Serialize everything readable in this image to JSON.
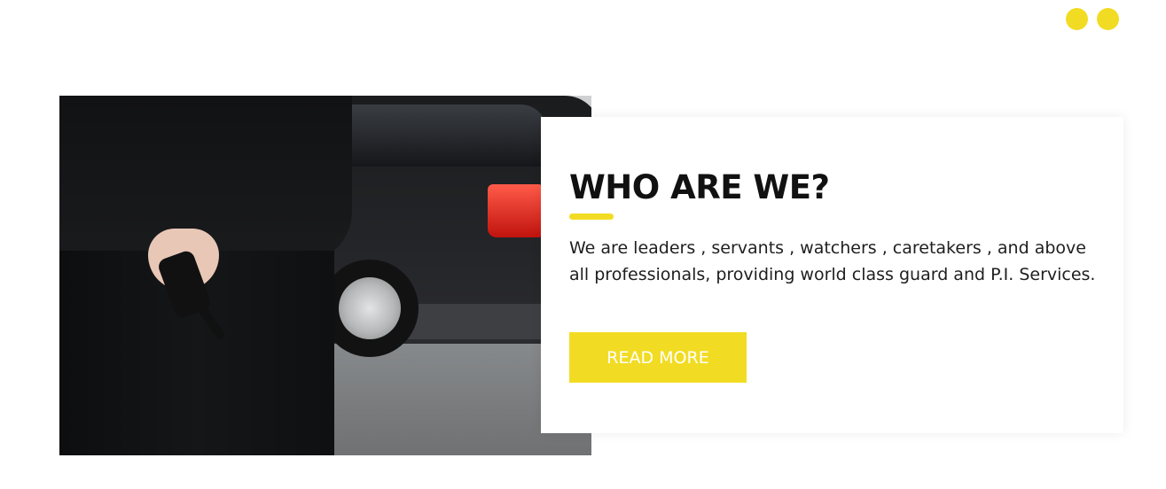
{
  "colors": {
    "accent": "#f2dc23",
    "heading": "#111111",
    "body_text": "#1e1e1e",
    "button_text": "#ffffff"
  },
  "carousel": {
    "dots": [
      "dot",
      "dot"
    ]
  },
  "about": {
    "title": "WHO ARE WE?",
    "description": "We are leaders , servants , watchers , caretakers , and above all professionals, providing world class guard and P.I. Services.",
    "button_label": "READ MORE"
  }
}
